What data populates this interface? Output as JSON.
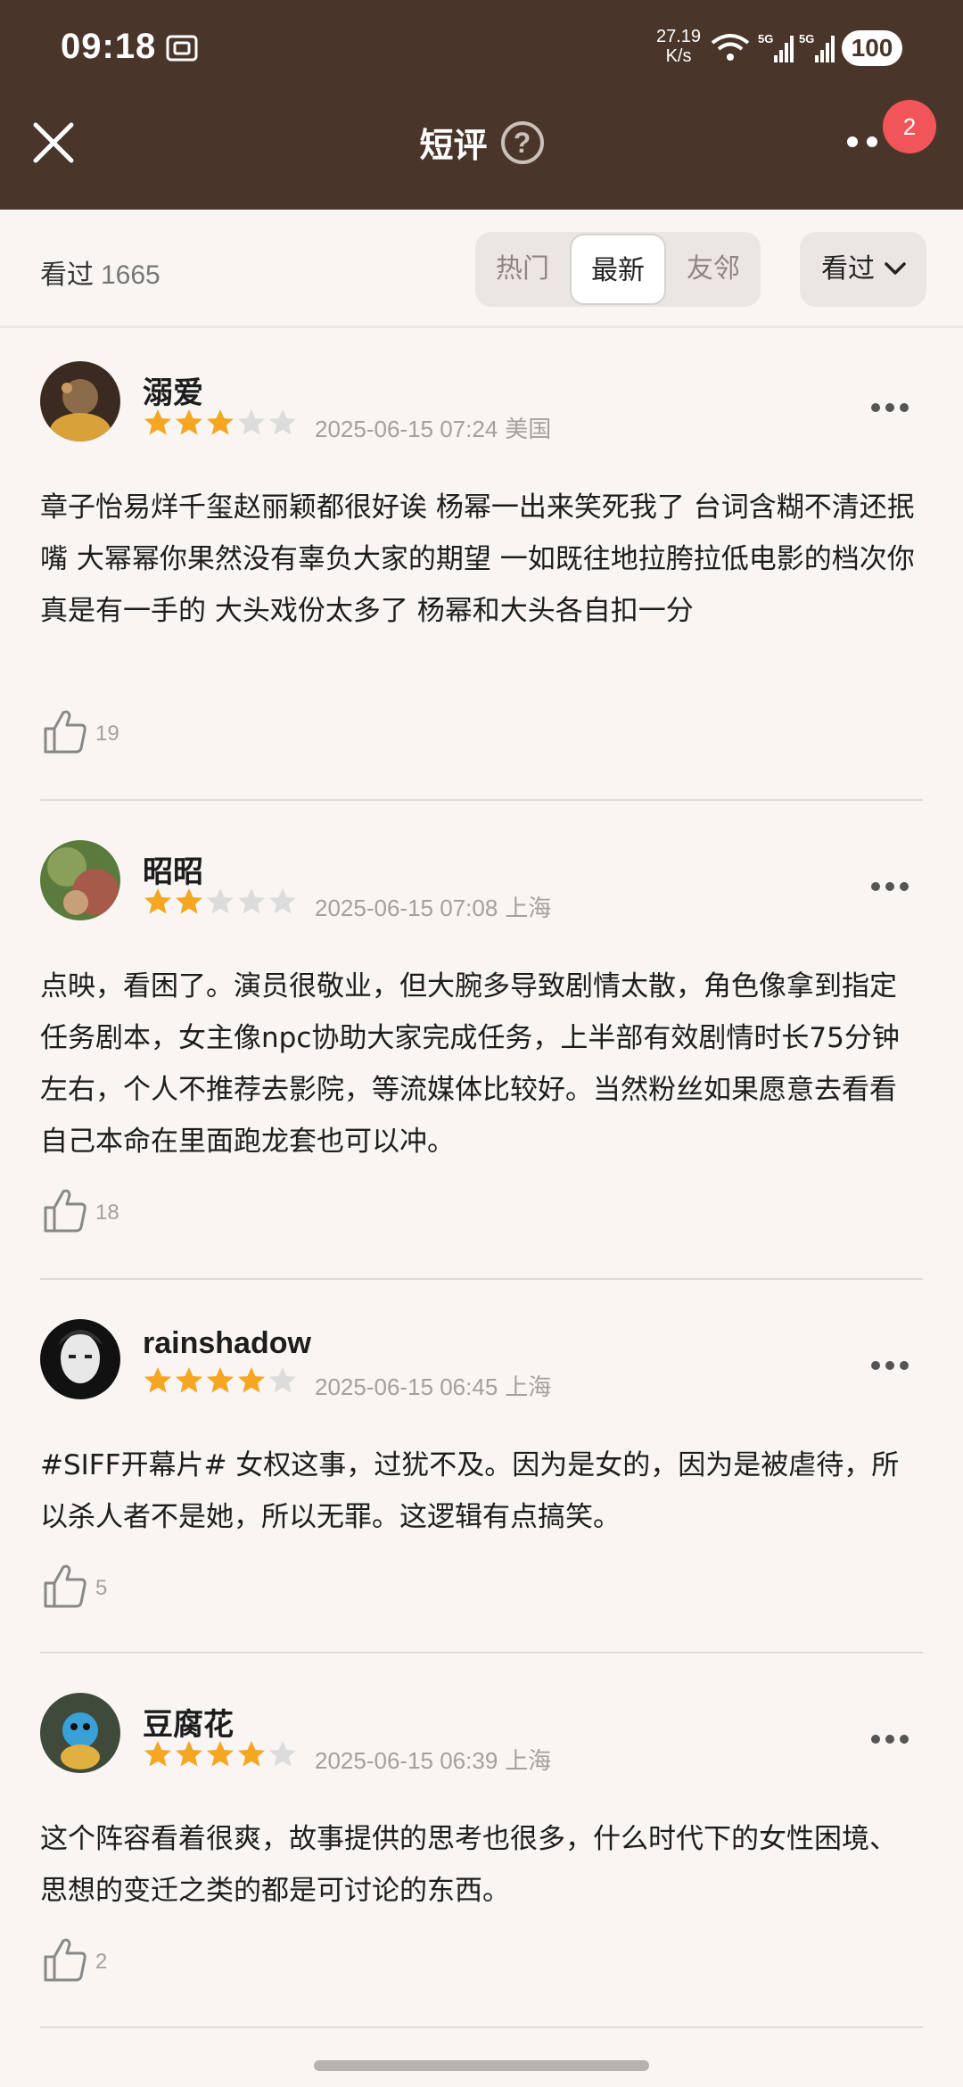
{
  "status_bar": {
    "time": "09:18",
    "net_speed_value": "27.19",
    "net_speed_unit": "K/s",
    "battery": "100",
    "icons": [
      "screenshot-icon",
      "wifi-icon",
      "signal-5g-icon",
      "signal-5g-icon"
    ]
  },
  "header": {
    "title": "短评",
    "help_icon": "?",
    "notification_count": "2"
  },
  "filter": {
    "watched_label": "看过",
    "watched_count": "1665",
    "tabs": [
      {
        "label": "热门",
        "active": false
      },
      {
        "label": "最新",
        "active": true
      },
      {
        "label": "友邻",
        "active": false
      }
    ],
    "dropdown_label": "看过"
  },
  "colors": {
    "header_bg": "#4a352b",
    "star_filled": "#f5a623",
    "star_empty": "#dcdcdc",
    "badge": "#f25559",
    "page_bg": "#f8f5f3"
  },
  "reviews": [
    {
      "username": "溺爱",
      "rating": 3,
      "timestamp": "2025-06-15 07:24",
      "location": "美国",
      "content": "章子怡易烊千玺赵丽颖都很好诶   杨幂一出来笑死我了  台词含糊不清还抿嘴  大幂幂你果然没有辜负大家的期望 一如既往地拉胯拉低电影的档次你真是有一手的  大头戏份太多了  杨幂和大头各自扣一分",
      "likes": "19"
    },
    {
      "username": "昭昭",
      "rating": 2,
      "timestamp": "2025-06-15 07:08",
      "location": "上海",
      "content": "点映，看困了。演员很敬业，但大腕多导致剧情太散，角色像拿到指定任务剧本，女主像npc协助大家完成任务，上半部有效剧情时长75分钟左右，个人不推荐去影院，等流媒体比较好。当然粉丝如果愿意去看看自己本命在里面跑龙套也可以冲。",
      "likes": "18"
    },
    {
      "username": "rainshadow",
      "rating": 4,
      "timestamp": "2025-06-15 06:45",
      "location": "上海",
      "content": "#SIFF开幕片# 女权这事，过犹不及。因为是女的，因为是被虐待，所以杀人者不是她，所以无罪。这逻辑有点搞笑。",
      "likes": "5"
    },
    {
      "username": "豆腐花",
      "rating": 4,
      "timestamp": "2025-06-15 06:39",
      "location": "上海",
      "content": "这个阵容看着很爽，故事提供的思考也很多，什么时代下的女性困境、思想的变迁之类的都是可讨论的东西。",
      "likes": "2"
    }
  ]
}
